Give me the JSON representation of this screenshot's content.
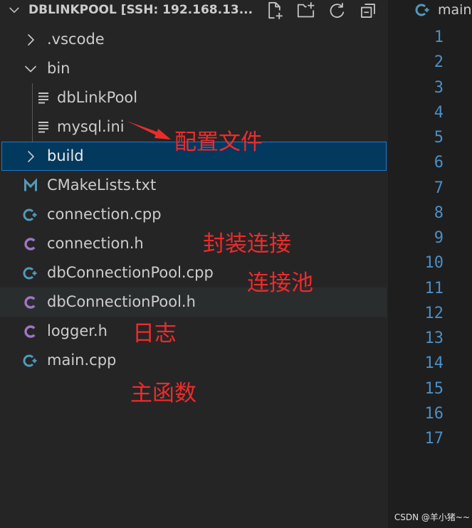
{
  "explorer": {
    "title": "DBLINKPOOL [SSH: 192.168.13...",
    "collapse_icon": "chevron-down-icon",
    "toolbar_icons": [
      "new-file-icon",
      "new-folder-icon",
      "refresh-icon",
      "collapse-all-icon"
    ],
    "tree": [
      {
        "label": ".vscode",
        "icon": "chevron-right-icon",
        "expanded": false
      },
      {
        "label": "bin",
        "icon": "chevron-down-icon",
        "expanded": true,
        "children": [
          {
            "label": "dbLinkPool",
            "icon": "file-lines-icon"
          },
          {
            "label": "mysql.ini",
            "icon": "file-lines-icon"
          }
        ]
      },
      {
        "label": "build",
        "icon": "chevron-right-icon",
        "expanded": false,
        "selected": true
      },
      {
        "label": "CMakeLists.txt",
        "icon": "cmake-icon"
      },
      {
        "label": "connection.cpp",
        "icon": "cpp-icon"
      },
      {
        "label": "connection.h",
        "icon": "c-header-icon"
      },
      {
        "label": "dbConnectionPool.cpp",
        "icon": "cpp-icon"
      },
      {
        "label": "dbConnectionPool.h",
        "icon": "c-header-icon",
        "hovered": true
      },
      {
        "label": "logger.h",
        "icon": "c-header-icon"
      },
      {
        "label": "main.cpp",
        "icon": "cpp-icon"
      }
    ]
  },
  "editor": {
    "tab": {
      "label": "main",
      "icon": "cpp-icon"
    },
    "line_numbers": [
      "1",
      "2",
      "3",
      "4",
      "5",
      "6",
      "7",
      "8",
      "9",
      "10",
      "11",
      "12",
      "13",
      "14",
      "15",
      "16",
      "17"
    ]
  },
  "annotations": [
    "配置文件",
    "封装连接",
    "连接池",
    "日志",
    "主函数"
  ],
  "watermark": "CSDN @羊小猪~~",
  "colors": {
    "sidebar_bg": "#252526",
    "editor_bg": "#1e1e1e",
    "selection_bg": "#04395e",
    "focus_border": "#1f76c8",
    "hover_bg": "#2a2d2e",
    "cpp_icon": "#519aba",
    "header_icon": "#a074c4",
    "line_number": "#4b8fc6",
    "annotation_red": "#ee2b2b"
  }
}
